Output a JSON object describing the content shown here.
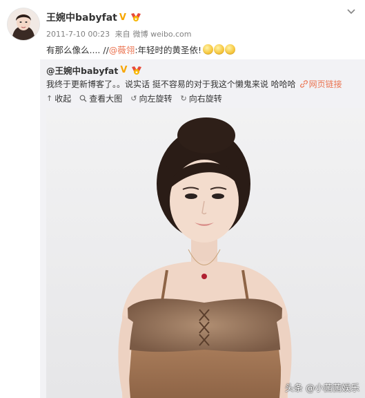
{
  "post": {
    "author": "王婉中babyfat",
    "timestamp": "2011-7-10 00:23",
    "source_prefix": "来自",
    "source": "微博 weibo.com",
    "text_before": "有那么像么.... //",
    "mention": "@薇翎",
    "text_after": ":年轻时的黄圣依!",
    "emoji_count": 3
  },
  "repost": {
    "author": "@王婉中babyfat",
    "text": "我终于更新博客了。。说实话 挺不容易的对于我这个懒鬼来说 哈哈哈",
    "link_label": "网页链接"
  },
  "toolbar": {
    "collapse": "收起",
    "view_large": "查看大图",
    "rotate_left": "向左旋转",
    "rotate_right": "向右旋转"
  },
  "watermark": "头条 @小茜茜娱乐",
  "colors": {
    "accent": "#eb7350",
    "verified": "#f7a600",
    "repost_bg": "#f2f2f5",
    "meta_text": "#808080"
  },
  "icons": {
    "verified": "verified-v-icon",
    "medal": "medal-icon",
    "dropdown": "chevron-down-icon",
    "collapse": "arrow-up-icon",
    "view_large": "magnifier-icon",
    "rotate_left": "rotate-left-icon",
    "rotate_right": "rotate-right-icon",
    "link": "link-icon"
  }
}
